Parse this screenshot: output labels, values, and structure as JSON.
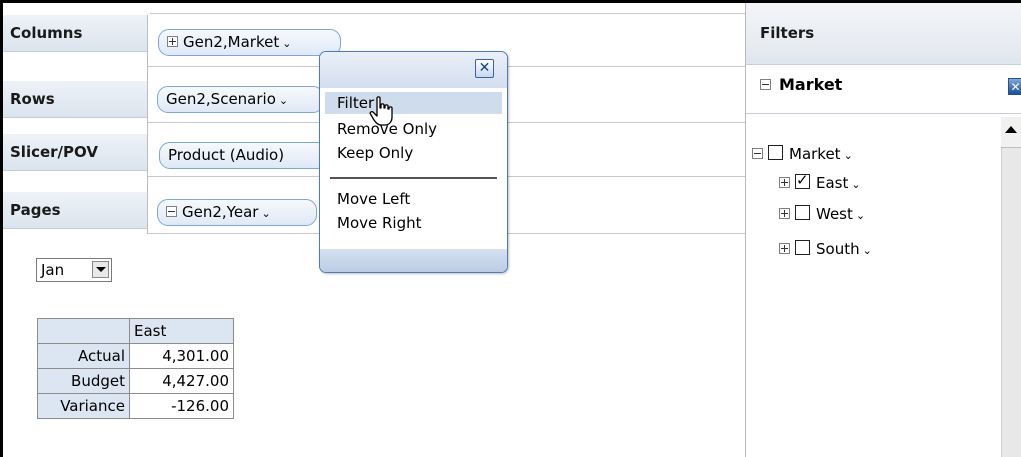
{
  "axes": {
    "columns": {
      "label": "Columns",
      "pill": "Gen2,Market"
    },
    "rows": {
      "label": "Rows",
      "pill": "Gen2,Scenario"
    },
    "slicer": {
      "label": "Slicer/POV",
      "pill": "Product (Audio)"
    },
    "pages": {
      "label": "Pages",
      "pill": "Gen2,Year"
    }
  },
  "page_select": {
    "value": "Jan"
  },
  "grid": {
    "column_header": "East",
    "rows": [
      {
        "label": "Actual",
        "value": "4,301.00"
      },
      {
        "label": "Budget",
        "value": "4,427.00"
      },
      {
        "label": "Variance",
        "value": "-126.00"
      }
    ]
  },
  "popup": {
    "close_glyph": "✕",
    "items": [
      "Filter",
      "Remove Only",
      "Keep Only"
    ],
    "items2": [
      "Move Left",
      "Move Right"
    ]
  },
  "filters": {
    "title": "Filters",
    "market_header": "Market",
    "close_glyph": "✕",
    "tree": [
      {
        "label": "Market",
        "checked": false
      },
      {
        "label": "East",
        "checked": true
      },
      {
        "label": "West",
        "checked": false
      },
      {
        "label": "South",
        "checked": false
      }
    ]
  },
  "icons": {
    "chevron": "⌄"
  }
}
